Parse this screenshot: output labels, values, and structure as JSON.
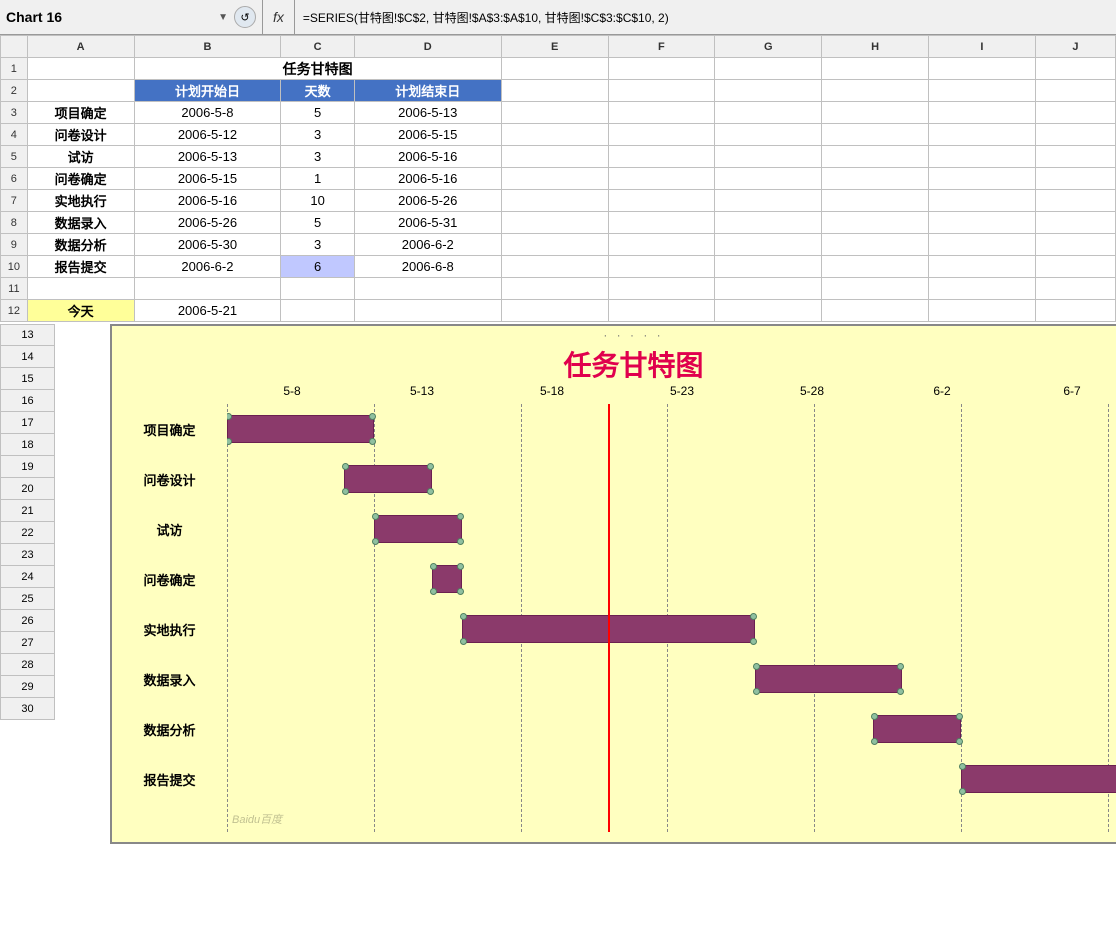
{
  "topbar": {
    "chart_name": "Chart 16",
    "arrow_icon": "▼",
    "refresh_icon": "↺",
    "fx_label": "fx",
    "formula": "=SERIES(甘特图!$C$2, 甘特图!$A$3:$A$10, 甘特图!$C$3:$C$10, 2)"
  },
  "spreadsheet": {
    "col_headers": [
      "",
      "A",
      "B",
      "C",
      "D",
      "E",
      "F",
      "G",
      "H",
      "I",
      "J"
    ],
    "row1": {
      "num": "1",
      "merged_title": "任务甘特图"
    },
    "row2": {
      "num": "2",
      "b": "计划开始日",
      "c": "天数",
      "d": "计划结束日"
    },
    "rows": [
      {
        "num": "3",
        "a": "项目确定",
        "b": "2006-5-8",
        "c": "5",
        "d": "2006-5-13"
      },
      {
        "num": "4",
        "a": "问卷设计",
        "b": "2006-5-12",
        "c": "3",
        "d": "2006-5-15"
      },
      {
        "num": "5",
        "a": "试访",
        "b": "2006-5-13",
        "c": "3",
        "d": "2006-5-16"
      },
      {
        "num": "6",
        "a": "问卷确定",
        "b": "2006-5-15",
        "c": "1",
        "d": "2006-5-16"
      },
      {
        "num": "7",
        "a": "实地执行",
        "b": "2006-5-16",
        "c": "10",
        "d": "2006-5-26"
      },
      {
        "num": "8",
        "a": "数据录入",
        "b": "2006-5-26",
        "c": "5",
        "d": "2006-5-31"
      },
      {
        "num": "9",
        "a": "数据分析",
        "b": "2006-5-30",
        "c": "3",
        "d": "2006-6-2"
      },
      {
        "num": "10",
        "a": "报告提交",
        "b": "2006-6-2",
        "c": "6",
        "d": "2006-6-8"
      }
    ],
    "row11": {
      "num": "11"
    },
    "row12": {
      "num": "12",
      "a": "今天",
      "b": "2006-5-21"
    }
  },
  "chart": {
    "title": "任务甘特图",
    "x_labels": [
      "5-8",
      "5-13",
      "5-18",
      "5-23",
      "5-28",
      "6-2",
      "6-7"
    ],
    "y_labels": [
      "项目确定",
      "问卷设计",
      "试访",
      "问卷确定",
      "实地执行",
      "数据录入",
      "数据分析",
      "报告提交"
    ],
    "handle_dots": "· · · · ·",
    "scroll_dots": "· · ·",
    "watermark": "Baidu百度"
  }
}
